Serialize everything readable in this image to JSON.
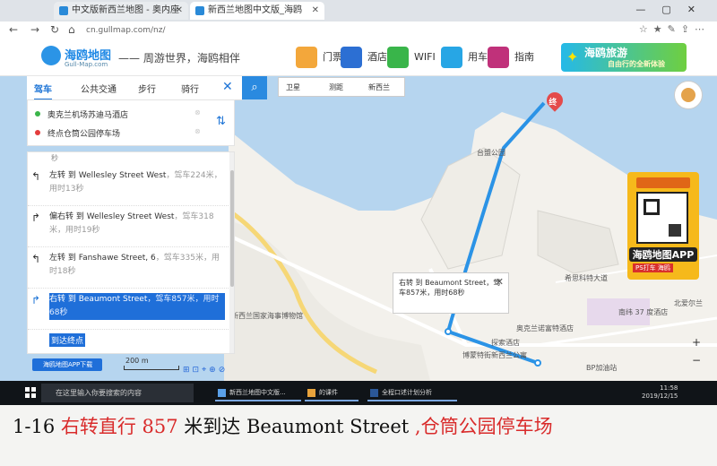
{
  "browser": {
    "tabs": [
      "中文版新西兰地图 - 奥内座",
      "新西兰地图中文版_海鸥"
    ],
    "url": "cn.gullmap.com/nz/"
  },
  "site": {
    "logo_name": "海鸥地图",
    "logo_domain": "Gull-Map.com",
    "slogan": "—— 周游世界，海鸥相伴",
    "services": [
      "门票",
      "酒店",
      "WIFI",
      "用车",
      "指南"
    ],
    "promo_title": "海鸥旅游",
    "promo_sub": "自由行的全新体验"
  },
  "route_panel": {
    "modes": [
      "驾车",
      "公共交通",
      "步行",
      "骑行"
    ],
    "active_mode": "驾车",
    "origin": "奥克兰机场苏迪马酒店",
    "destination": "终点仓筒公园停车场",
    "prev_tail": "秒",
    "steps": [
      {
        "action": "左转 到 Wellesley Street West",
        "meta": "，驾车224米，用时13秒",
        "highlighted": false
      },
      {
        "action": "偏右转 到 Wellesley Street West",
        "meta": "，驾车318米，用时19秒",
        "highlighted": false
      },
      {
        "action": "左转 到 Fanshawe Street, 6",
        "meta": "，驾车335米，用时18秒",
        "highlighted": false
      },
      {
        "action": "右转 到 Beaumont Street",
        "meta": "，驾车857米，用时68秒",
        "highlighted": true
      }
    ],
    "more_link": "到达终点"
  },
  "map": {
    "layer_options": [
      "卫星",
      "测距",
      "新西兰"
    ],
    "labels": [
      "台盟公园",
      "新西兰国家海事博物馆",
      "希思科特大道",
      "奥克兰诺富特酒店",
      "南纬 37 度酒店",
      "BP加油站",
      "博蒙特街新西兰公寓",
      "探索酒店",
      "北爱尔兰"
    ],
    "pin_label": "终",
    "popup": "右转 到 Beaumont Street，驾车857米，用时68秒",
    "qr_title": "海鸥地图APP",
    "qr_sub": "PS打车 海鸥",
    "app_badge": "海鸥地图APP下载",
    "scale": "200 m",
    "zoom_in": "+",
    "zoom_out": "−"
  },
  "taskbar": {
    "search_placeholder": "在这里输入你要搜索的内容",
    "apps": [
      "新西兰地图中文版...",
      "的课件",
      "全程口述计划分析"
    ],
    "time": "11:58",
    "date": "2019/12/15"
  },
  "caption": {
    "prefix": "1-16 ",
    "part1": "右转直行 857 ",
    "part2": "米到达 Beaumont Street",
    "part3": " ,仓筒公园停车场"
  },
  "colors": {
    "route": "#2b93e6",
    "highlight": "#1f6fd9",
    "caption_red": "#d92b2b",
    "water": "#b6d5ef"
  }
}
